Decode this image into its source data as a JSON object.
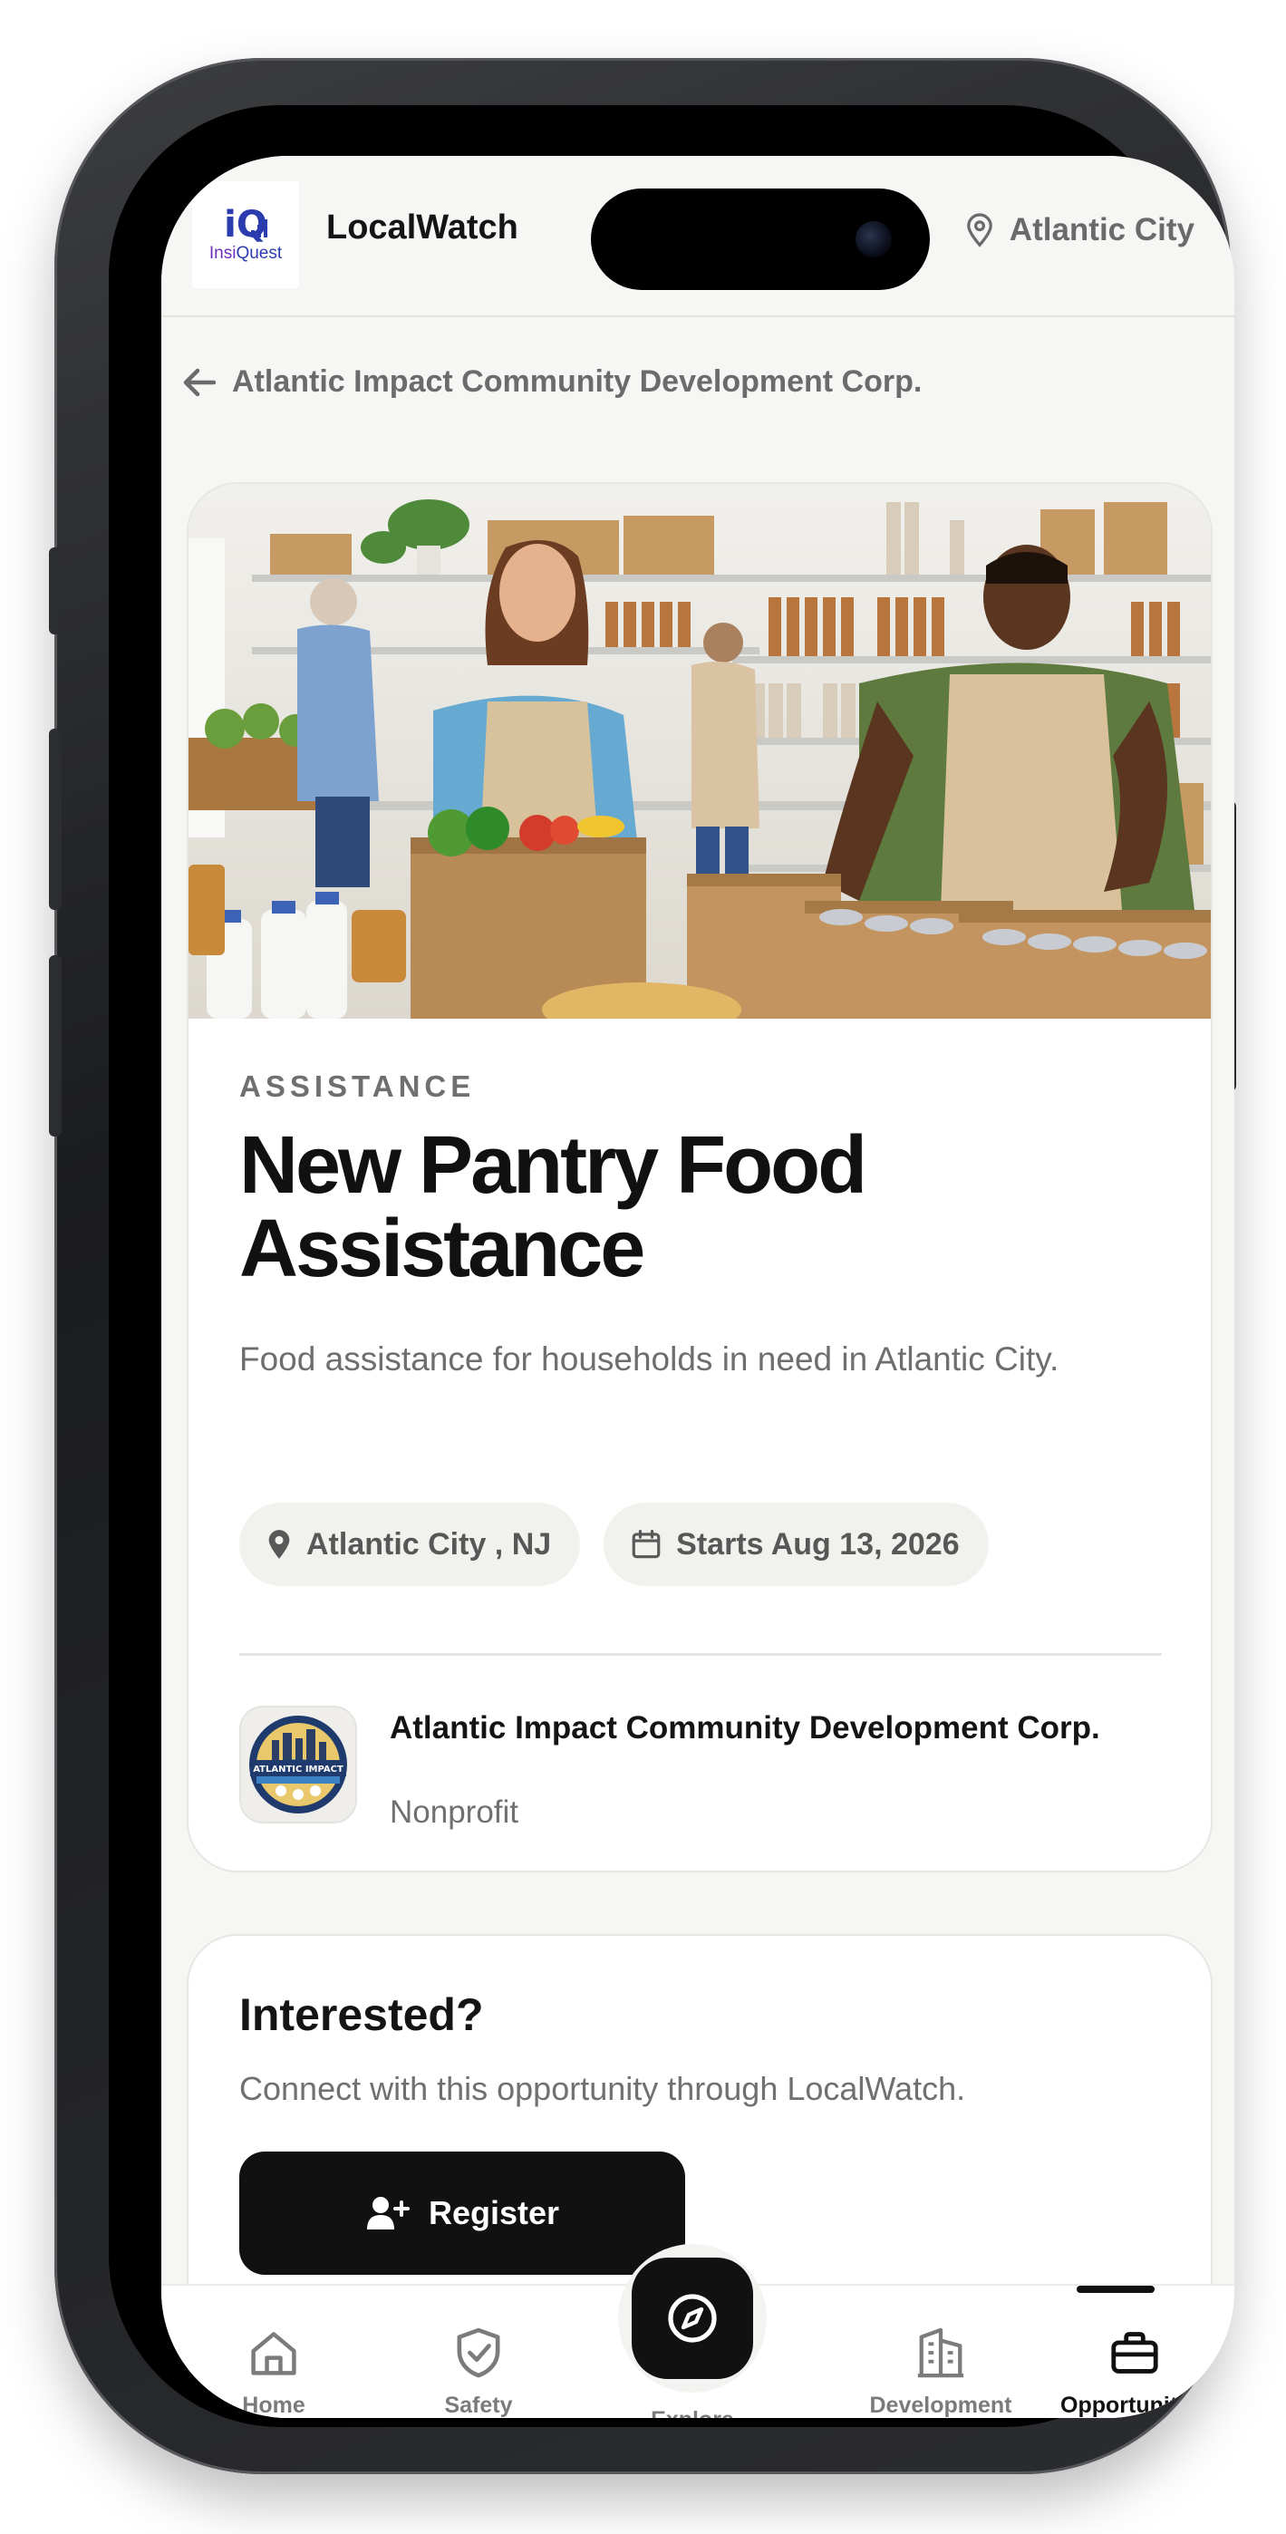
{
  "header": {
    "logo_text": "iQ",
    "logo_word_1": "Insi",
    "logo_word_2": "Quest",
    "app_title": "LocalWatch",
    "location": "Atlantic City"
  },
  "breadcrumb": {
    "back_label": "Atlantic Impact Community Development Corp."
  },
  "opportunity": {
    "category": "ASSISTANCE",
    "title": "New Pantry Food Assistance",
    "description": "Food assistance for households in need in Atlantic City.",
    "location_chip": "Atlantic City , NJ",
    "date_chip": "Starts Aug 13, 2026"
  },
  "organization": {
    "name": "Atlantic Impact Community Development Corp.",
    "type": "Nonprofit",
    "logo_text": "ATLANTIC IMPACT"
  },
  "interest": {
    "title": "Interested?",
    "subtitle": "Connect with this opportunity through LocalWatch.",
    "register_label": "Register"
  },
  "nav": {
    "home": "Home",
    "safety": "Safety",
    "explore": "Explore",
    "development": "Development",
    "opportunities": "Opportunities",
    "active": "Opportunities"
  },
  "colors": {
    "primary": "#111111",
    "background": "#f6f6f4",
    "card": "#ffffff",
    "muted_text": "#6e6e6e"
  }
}
